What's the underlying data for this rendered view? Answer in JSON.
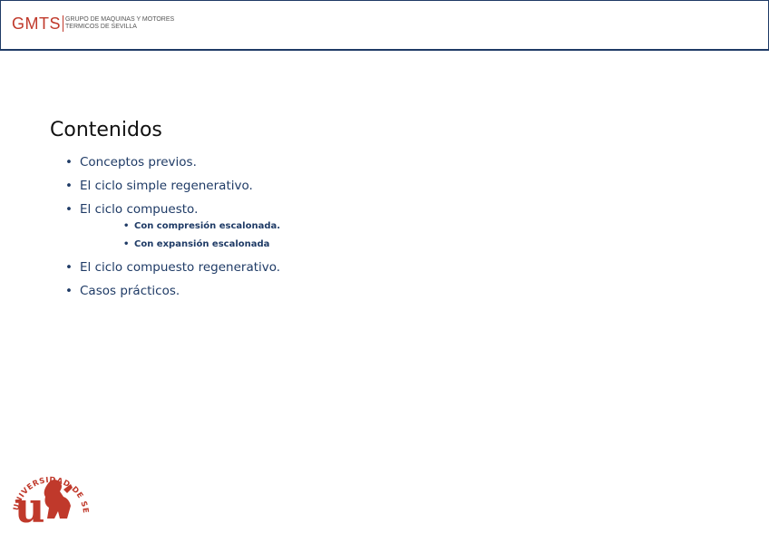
{
  "header": {
    "logo_mark": "GMTS",
    "logo_line1": "GRUPO DE MAQUINAS Y MOTORES",
    "logo_line2": "TERMICOS DE SEVILLA"
  },
  "slide": {
    "title": "Contenidos",
    "items": [
      {
        "label": "Conceptos previos."
      },
      {
        "label": "El ciclo simple regenerativo."
      },
      {
        "label": "El ciclo compuesto.",
        "sub": [
          "Con compresión escalonada.",
          "Con expansión escalonada"
        ]
      },
      {
        "label": "El ciclo compuesto regenerativo."
      },
      {
        "label": "Casos prácticos."
      }
    ]
  },
  "footer": {
    "seal_text": "UNIVERSIDAD DE SEVILLA",
    "seal_letter": "u"
  },
  "colors": {
    "accent_blue": "#1f3b66",
    "brand_red": "#c0392b"
  }
}
